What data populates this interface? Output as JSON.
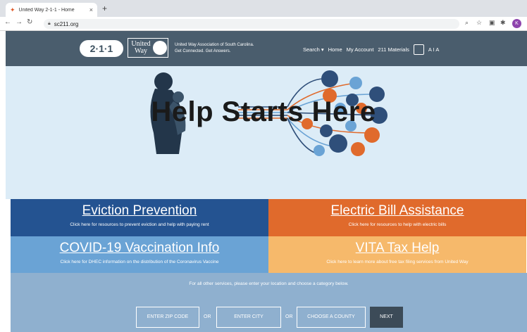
{
  "browser": {
    "tab_title": "United Way 2-1-1 - Home",
    "tab_close": "×",
    "new_tab": "+",
    "url": "sc211.org",
    "avatar_letter": "K"
  },
  "header": {
    "logo_211": "2·1·1",
    "logo_uw_line1": "United",
    "logo_uw_line2": "Way",
    "tagline_line1": "United Way Association of South Carolina.",
    "tagline_line2": "Get Connected. Get Answers.",
    "nav": {
      "search": "Search ▾",
      "home": "Home",
      "account": "My Account",
      "materials": "211 Materials",
      "font_size": "A I A"
    }
  },
  "hero": {
    "headline": "Help Starts Here"
  },
  "tiles": [
    {
      "title": "Eviction Prevention",
      "subtitle": "Click here for resources to prevent eviction and help with paying rent",
      "color": "#245391"
    },
    {
      "title": "Electric Bill Assistance",
      "subtitle": "Click here for resources to help with electric bills",
      "color": "#e06a2c"
    },
    {
      "title": "COVID-19 Vaccination Info",
      "subtitle": "Click here for DHEC information on the distribution of the Coronavirus Vaccine",
      "color": "#6aa3d5"
    },
    {
      "title": "VITA Tax Help",
      "subtitle": "Click here to learn more about free tax filing services from United Way",
      "color": "#f6b96b"
    }
  ],
  "search": {
    "hint": "For all other services, please enter your location and choose a category below.",
    "zip_placeholder": "ENTER ZIP CODE",
    "or_label": "OR",
    "city_placeholder": "ENTER CITY",
    "county_label": "CHOOSE A COUNTY",
    "next_label": "NEXT"
  }
}
